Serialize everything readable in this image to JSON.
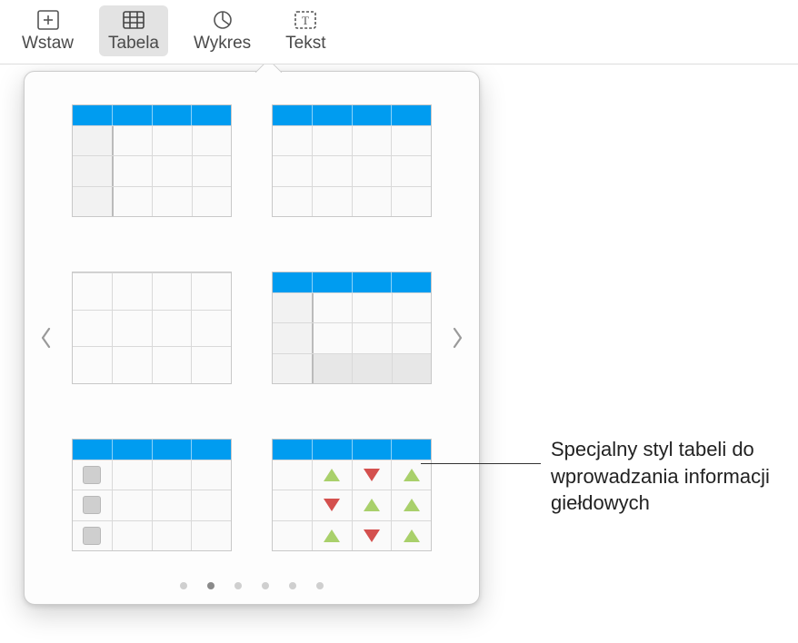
{
  "toolbar": {
    "items": [
      {
        "id": "insert",
        "label": "Wstaw",
        "icon": "plus-box"
      },
      {
        "id": "table",
        "label": "Tabela",
        "icon": "table",
        "active": true
      },
      {
        "id": "chart",
        "label": "Wykres",
        "icon": "pie"
      },
      {
        "id": "text",
        "label": "Tekst",
        "icon": "text-box"
      }
    ]
  },
  "popover": {
    "pages": {
      "count": 6,
      "active_index": 1
    },
    "styles": [
      {
        "id": "header-index",
        "icon": "header-index-col"
      },
      {
        "id": "header-plain",
        "icon": "header-plain"
      },
      {
        "id": "plain-grid",
        "icon": "plain-grid"
      },
      {
        "id": "header-index-footer",
        "icon": "header-index-footer"
      },
      {
        "id": "checkbox-col",
        "icon": "checkbox-col"
      },
      {
        "id": "stock",
        "icon": "stock-arrows"
      }
    ]
  },
  "callout": {
    "text": "Specjalny styl tabeli do wprowadzania informacji giełdowych"
  }
}
